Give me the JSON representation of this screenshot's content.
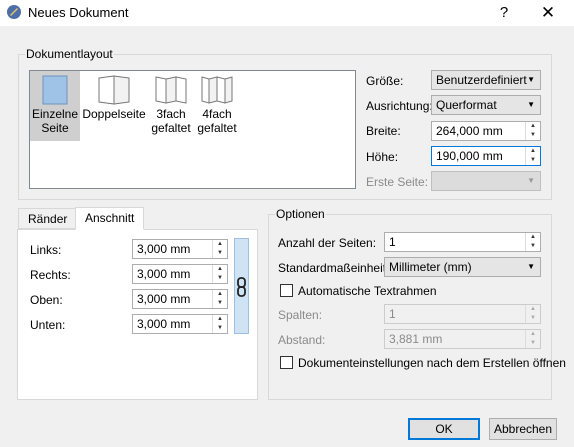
{
  "window": {
    "title": "Neues Dokument",
    "help": "?",
    "close": "✕",
    "icon": "scribus-icon"
  },
  "layout_group": {
    "title": "Dokumentlayout",
    "items": [
      {
        "label_line1": "Einzelne",
        "label_line2": "Seite",
        "selected": true
      },
      {
        "label_line1": "Doppelseite",
        "label_line2": "",
        "selected": false
      },
      {
        "label_line1": "3fach",
        "label_line2": "gefaltet",
        "selected": false
      },
      {
        "label_line1": "4fach",
        "label_line2": "gefaltet",
        "selected": false
      }
    ],
    "size_label": "Größe:",
    "size_value": "Benutzerdefiniert",
    "orientation_label": "Ausrichtung:",
    "orientation_value": "Querformat",
    "width_label": "Breite:",
    "width_value": "264,000 mm",
    "height_label": "Höhe:",
    "height_value": "190,000 mm",
    "first_page_label": "Erste Seite:",
    "first_page_value": ""
  },
  "tabs": {
    "items": [
      "Ränder",
      "Anschnitt"
    ],
    "active": "Anschnitt",
    "fields": [
      {
        "label": "Links:",
        "value": "3,000 mm"
      },
      {
        "label": "Rechts:",
        "value": "3,000 mm"
      },
      {
        "label": "Oben:",
        "value": "3,000 mm"
      },
      {
        "label": "Unten:",
        "value": "3,000 mm"
      }
    ]
  },
  "options": {
    "title": "Optionen",
    "pages_label": "Anzahl der Seiten:",
    "pages_value": "1",
    "unit_label": "Standardmaßeinheit:",
    "unit_value": "Millimeter (mm)",
    "auto_frames_label": "Automatische Textrahmen",
    "auto_frames_checked": false,
    "columns_label": "Spalten:",
    "columns_value": "1",
    "gap_label": "Abstand:",
    "gap_value": "3,881 mm",
    "open_settings_label": "Dokumenteinstellungen nach dem Erstellen öffnen",
    "open_settings_checked": false
  },
  "buttons": {
    "ok": "OK",
    "cancel": "Abbrechen"
  },
  "colors": {
    "accent": "#0078d7",
    "selection": "#cfcfcf",
    "chain_bg": "#cfe3f5"
  }
}
